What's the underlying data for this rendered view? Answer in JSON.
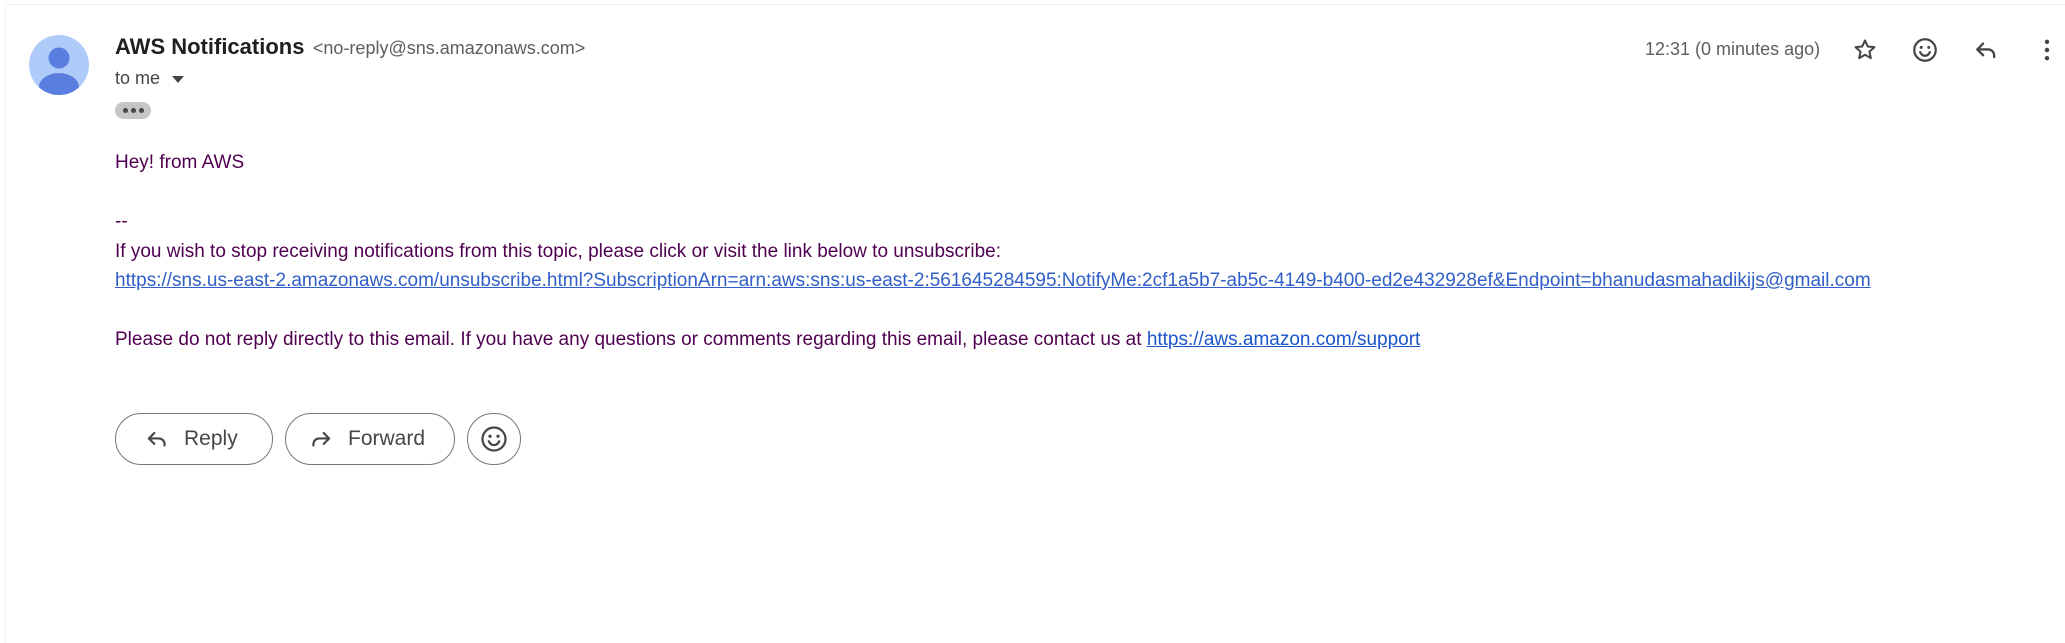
{
  "sender": {
    "name": "AWS Notifications",
    "email": "<no-reply@sns.amazonaws.com>"
  },
  "recipient": {
    "label": "to me"
  },
  "header": {
    "timestamp": "12:31 (0 minutes ago)",
    "icons": [
      "star-icon",
      "emoji-icon",
      "reply-icon",
      "more-vert-icon"
    ]
  },
  "body": {
    "greeting": "Hey! from AWS",
    "separator": "--",
    "unsubscribe_text": "If you wish to stop receiving notifications from this topic, please click or visit the link below to unsubscribe:",
    "unsubscribe_link": "https://sns.us-east-2.amazonaws.com/unsubscribe.html?SubscriptionArn=arn:aws:sns:us-east-2:561645284595:NotifyMe:2cf1a5b7-ab5c-4149-b400-ed2e432928ef&Endpoint=bhanudasmahadikijs@gmail.com",
    "support_text": "Please do not reply directly to this email. If you have any questions or comments regarding this email, please contact us at",
    "support_link": "https://aws.amazon.com/support"
  },
  "actions": {
    "reply_label": "Reply",
    "forward_label": "Forward"
  },
  "colors": {
    "body_text": "#500050",
    "link": "#1a55c9",
    "avatar_bg": "#aecbfa",
    "avatar_fg": "#5a7ee0"
  }
}
